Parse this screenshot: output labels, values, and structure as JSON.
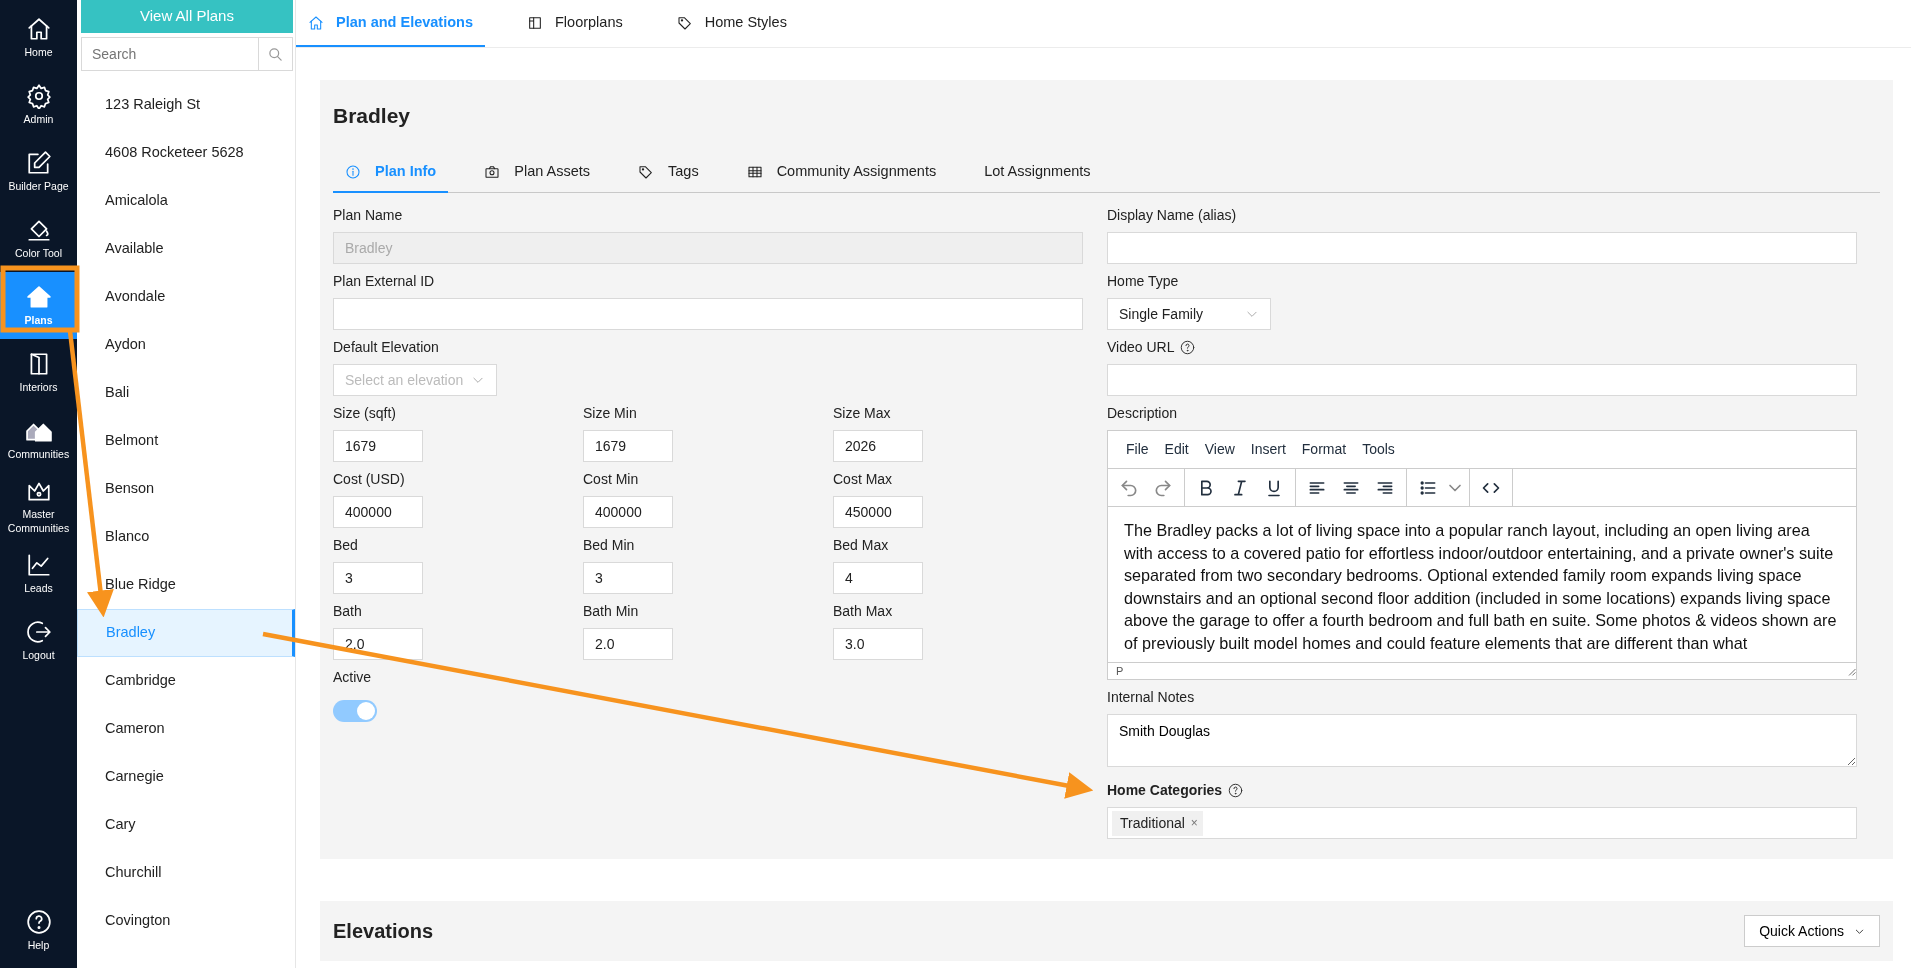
{
  "rail": {
    "items": [
      {
        "label": "Home",
        "selected": false
      },
      {
        "label": "Admin",
        "selected": false
      },
      {
        "label": "Builder Page",
        "selected": false
      },
      {
        "label": "Color Tool",
        "selected": false
      },
      {
        "label": "Plans",
        "selected": true
      },
      {
        "label": "Interiors",
        "selected": false
      },
      {
        "label": "Communities",
        "selected": false
      },
      {
        "label": "Master Communities",
        "selected": false
      },
      {
        "label": "Leads",
        "selected": false
      },
      {
        "label": "Logout",
        "selected": false
      }
    ],
    "footer": {
      "label": "Help"
    }
  },
  "plans_list": {
    "button": "View All Plans",
    "search": {
      "placeholder": "Search"
    },
    "items": [
      {
        "label": "123 Raleigh St",
        "selected": false
      },
      {
        "label": "4608 Rocketeer 5628",
        "selected": false
      },
      {
        "label": "Amicalola",
        "selected": false
      },
      {
        "label": "Available",
        "selected": false
      },
      {
        "label": "Avondale",
        "selected": false
      },
      {
        "label": "Aydon",
        "selected": false
      },
      {
        "label": "Bali",
        "selected": false
      },
      {
        "label": "Belmont",
        "selected": false
      },
      {
        "label": "Benson",
        "selected": false
      },
      {
        "label": "Blanco",
        "selected": false
      },
      {
        "label": "Blue Ridge",
        "selected": false
      },
      {
        "label": "Bradley",
        "selected": true
      },
      {
        "label": "Cambridge",
        "selected": false
      },
      {
        "label": "Cameron",
        "selected": false
      },
      {
        "label": "Carnegie",
        "selected": false
      },
      {
        "label": "Cary",
        "selected": false
      },
      {
        "label": "Churchill",
        "selected": false
      },
      {
        "label": "Covington",
        "selected": false
      }
    ]
  },
  "top_tabs": [
    {
      "label": "Plan and Elevations",
      "selected": true
    },
    {
      "label": "Floorplans",
      "selected": false
    },
    {
      "label": "Home Styles",
      "selected": false
    }
  ],
  "plan": {
    "title": "Bradley",
    "tabs": [
      {
        "label": "Plan Info",
        "selected": true
      },
      {
        "label": "Plan Assets",
        "selected": false
      },
      {
        "label": "Tags",
        "selected": false
      },
      {
        "label": "Community Assignments",
        "selected": false
      },
      {
        "label": "Lot Assignments",
        "selected": false
      }
    ],
    "plan_name": {
      "label": "Plan Name",
      "value": "Bradley",
      "disabled": true
    },
    "external_id": {
      "label": "Plan External ID"
    },
    "default_elevation": {
      "label": "Default Elevation",
      "placeholder": "Select an elevation"
    },
    "number_rows": [
      [
        {
          "label": "Size (sqft)",
          "value": "1679"
        },
        {
          "label": "Size Min",
          "value": "1679"
        },
        {
          "label": "Size Max",
          "value": "2026"
        }
      ],
      [
        {
          "label": "Cost (USD)",
          "value": "400000"
        },
        {
          "label": "Cost Min",
          "value": "400000"
        },
        {
          "label": "Cost Max",
          "value": "450000"
        }
      ],
      [
        {
          "label": "Bed",
          "value": "3"
        },
        {
          "label": "Bed Min",
          "value": "3"
        },
        {
          "label": "Bed Max",
          "value": "4"
        }
      ],
      [
        {
          "label": "Bath",
          "value": "2.0"
        },
        {
          "label": "Bath Min",
          "value": "2.0"
        },
        {
          "label": "Bath Max",
          "value": "3.0"
        }
      ]
    ],
    "active": {
      "label": "Active",
      "on": true
    },
    "display_name": {
      "label": "Display Name (alias)"
    },
    "home_type": {
      "label": "Home Type",
      "value": "Single Family"
    },
    "video_url": {
      "label": "Video URL",
      "help": true
    },
    "description": {
      "label": "Description",
      "menu": [
        "File",
        "Edit",
        "View",
        "Insert",
        "Format",
        "Tools"
      ],
      "text": "The Bradley packs a lot of living space into a popular ranch layout, including an open living area with access to a covered patio for effortless indoor/outdoor entertaining, and a private owner's suite separated from two secondary bedrooms. Optional extended family room expands living space downstairs and an optional second floor addition (included in some locations) expands living space above the garage to offer a fourth bedroom and full bath en suite. Some photos & videos shown are of previously built model homes and could feature elements that are different than what",
      "status": "P"
    },
    "internal_notes": {
      "label": "Internal Notes",
      "value": "Smith Douglas"
    },
    "home_categories": {
      "label": "Home Categories",
      "help": true,
      "tags": [
        {
          "label": "Traditional",
          "close": "×"
        }
      ]
    }
  },
  "elevations": {
    "title": "Elevations",
    "button": "Quick Actions"
  },
  "callouts": [
    {
      "kind": "highlight"
    },
    {
      "kind": "arrow"
    },
    {
      "kind": "arrow"
    }
  ]
}
